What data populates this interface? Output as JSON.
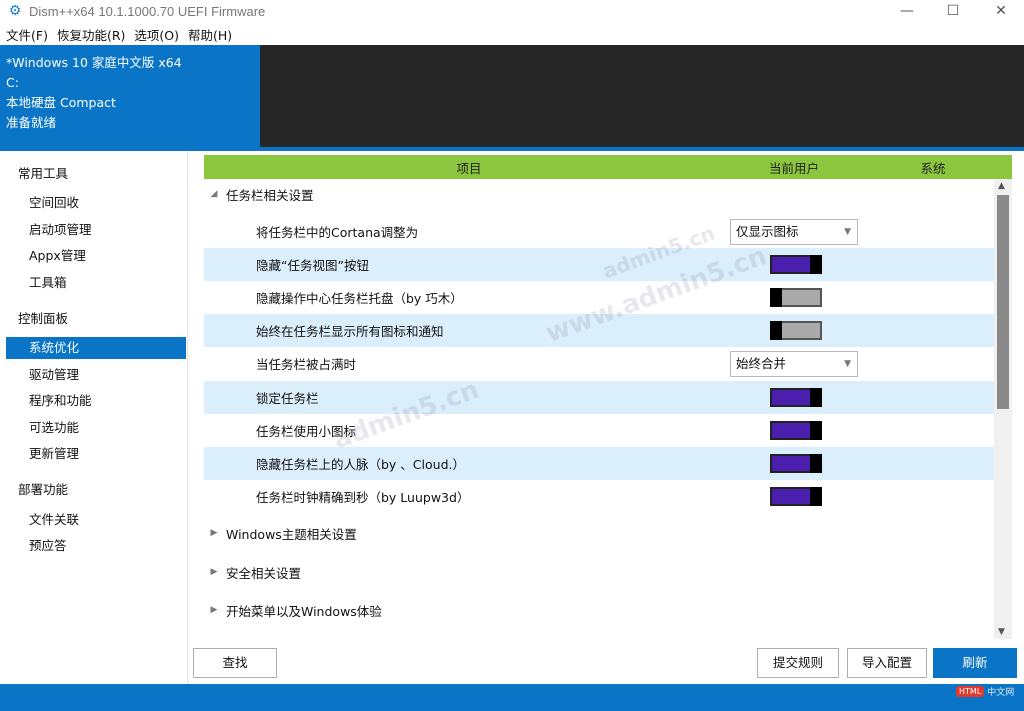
{
  "window": {
    "title": "Dism++x64 10.1.1000.70 UEFI Firmware",
    "min": "—",
    "max": "☐",
    "close": "✕"
  },
  "menu": [
    "文件(F)",
    "恢复功能(R)",
    "选项(O)",
    "帮助(H)"
  ],
  "header": {
    "os": "*Windows 10 家庭中文版 x64",
    "drive": "C:",
    "disk": "本地硬盘 Compact",
    "status": "准备就绪"
  },
  "sidebar": {
    "groups": [
      {
        "title": "常用工具",
        "items": [
          "空间回收",
          "启动项管理",
          "Appx管理",
          "工具箱"
        ]
      },
      {
        "title": "控制面板",
        "items": [
          "系统优化",
          "驱动管理",
          "程序和功能",
          "可选功能",
          "更新管理"
        ]
      },
      {
        "title": "部署功能",
        "items": [
          "文件关联",
          "预应答"
        ]
      }
    ],
    "active": "系统优化"
  },
  "table": {
    "col_item": "项目",
    "col_user": "当前用户",
    "col_system": "系统"
  },
  "sections": {
    "taskbar": "任务栏相关设置",
    "theme": "Windows主题相关设置",
    "security": "安全相关设置",
    "start": "开始菜单以及Windows体验"
  },
  "rows": [
    {
      "label": "将任务栏中的Cortana调整为",
      "type": "dropdown",
      "value": "仅显示图标"
    },
    {
      "label": "隐藏“任务视图”按钮",
      "type": "toggle",
      "on": true
    },
    {
      "label": "隐藏操作中心任务栏托盘（by 巧木）",
      "type": "toggle",
      "on": false
    },
    {
      "label": "始终在任务栏显示所有图标和通知",
      "type": "toggle",
      "on": false
    },
    {
      "label": "当任务栏被占满时",
      "type": "dropdown",
      "value": "始终合并"
    },
    {
      "label": "锁定任务栏",
      "type": "toggle",
      "on": true
    },
    {
      "label": "任务栏使用小图标",
      "type": "toggle",
      "on": true
    },
    {
      "label": "隐藏任务栏上的人脉（by 、Cloud.）",
      "type": "toggle",
      "on": true
    },
    {
      "label": "任务栏时钟精确到秒（by Luupw3d）",
      "type": "toggle",
      "on": true
    }
  ],
  "buttons": {
    "find": "查找",
    "submit": "提交规则",
    "import": "导入配置",
    "refresh": "刷新"
  },
  "watermark": {
    "text1": "www.admin5.cn",
    "text2": "admin5.cn",
    "text3": "admin5.cn",
    "logo_badge": "HTML",
    "logo_text": "中文网"
  },
  "colors": {
    "accent": "#0a75c6",
    "header_green": "#8cc63f",
    "toggle_on": "#4a1fae",
    "alt_row": "#dbeefb"
  }
}
